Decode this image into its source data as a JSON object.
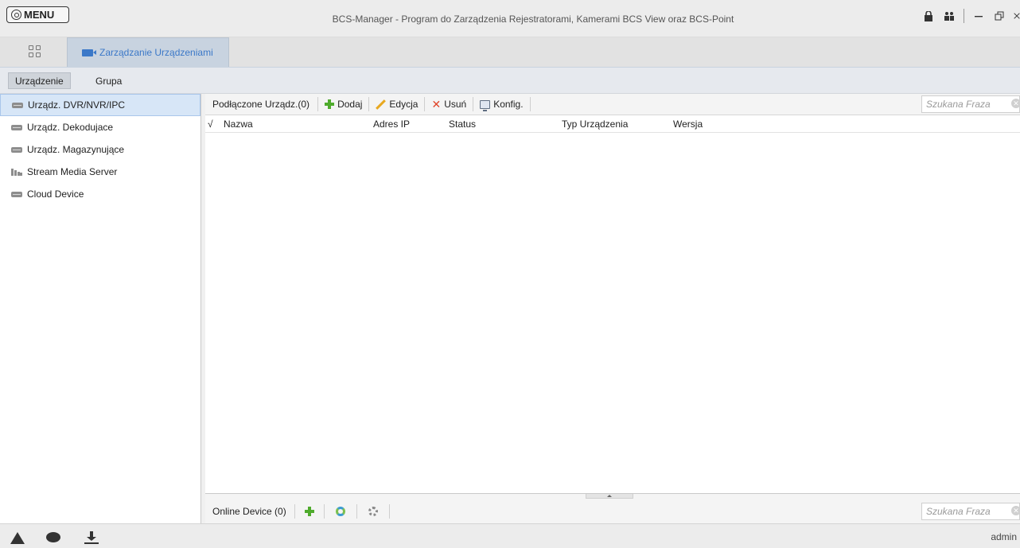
{
  "titlebar": {
    "menu_label": "MENU",
    "app_title": "BCS-Manager - Program do Zarządzenia Rejestratorami, Kamerami BCS View oraz BCS-Point"
  },
  "tabs": {
    "home_icon": "grid-icon",
    "active_label": "Zarządzanie Urządzeniami"
  },
  "subtabs": [
    "Urządzenie",
    "Grupa"
  ],
  "sidebar": {
    "items": [
      {
        "label": "Urządz. DVR/NVR/IPC",
        "selected": true
      },
      {
        "label": "Urządz. Dekodujace"
      },
      {
        "label": "Urządz. Magazynujące"
      },
      {
        "label": "Stream Media Server"
      },
      {
        "label": "Cloud Device"
      }
    ]
  },
  "toolbar": {
    "connected_label": "Podłączone Urządz.(0)",
    "add_label": "Dodaj",
    "edit_label": "Edycja",
    "delete_label": "Usuń",
    "config_label": "Konfig.",
    "search_placeholder": "Szukana Fraza"
  },
  "table": {
    "columns": [
      "√",
      "Nazwa",
      "Adres IP",
      "Status",
      "Typ Urządzenia",
      "Wersja"
    ]
  },
  "bottom": {
    "online_label": "Online Device (0)",
    "search_placeholder": "Szukana Fraza"
  },
  "statusbar": {
    "user": "admin"
  }
}
